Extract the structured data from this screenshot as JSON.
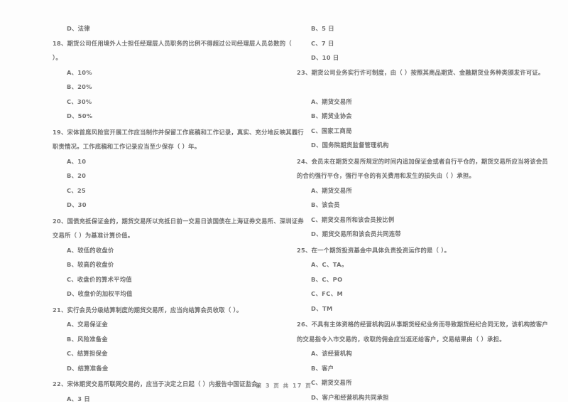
{
  "document": {
    "page_footer": "第 3 页  共 17 页",
    "page_number": "3",
    "total_pages": "17",
    "ink_color": "#5f5f5f",
    "paper_color": "#fdfdfd"
  },
  "left_column": {
    "orphan_option": "D、法律",
    "questions": [
      {
        "number": "18",
        "lines": [
          "18、期货公司任用境外人士担任经理层人员职务的比例不得超过公司经理层人员总数的（",
          "）。"
        ],
        "options": [
          "A、10%",
          "B、20%",
          "C、30%",
          "D、50%"
        ]
      },
      {
        "number": "19",
        "lines": [
          "19、宋体首席风险官开展工作应当制作并保留工作底稿和工作记录，真实、充分地反映其履行",
          "职责情况。工作底稿和工作记录应当至少保存（      ）年。"
        ],
        "options": [
          "A、10",
          "B、20",
          "C、25",
          "D、30"
        ]
      },
      {
        "number": "20",
        "lines": [
          "20、国债充抵保证金的，期货交易所以充抵日前一交易日该国债在上海证券交易所、深圳证券",
          "交易所（      ）为基准计算价值。"
        ],
        "options": [
          "A、较低的收盘价",
          "B、较高的收盘价",
          "C、收盘价的算术平均值",
          "D、收盘价的加权平均值"
        ]
      },
      {
        "number": "21",
        "lines": [
          "21、实行会员分级结算制度的期货交易所，应当向结算会员收取（      ）。"
        ],
        "options": [
          "A、交易保证金",
          "B、风险准备金",
          "C、结算担保金",
          "D、结算准备金"
        ]
      },
      {
        "number": "22",
        "lines": [
          "22、宋体期货交易所联网交易的，应当于决定之日起（      ）内报告中国证监会。"
        ],
        "options": [
          "A、3 日"
        ]
      }
    ]
  },
  "right_column": {
    "orphan_options": [
      "B、5 日",
      "C、7 日",
      "D、10 日"
    ],
    "questions": [
      {
        "number": "23",
        "lines": [
          "23、期货公司业务实行许可制度，由（      ）按照其商品期货、金融期货业务种类颁发许可证。"
        ],
        "options": [
          "A、期货交易所",
          "B、期货业协会",
          "C、国家工商局",
          "D、国务院期货监督管理机构"
        ]
      },
      {
        "number": "24",
        "lines": [
          "24、会员未在期货交易所规定的时间内追加保证金或者自行平仓的，期货交易所应当将该会员",
          "的合约强行平仓，强行平仓的有关费用和发生的损失由（      ）承担。"
        ],
        "options": [
          "A、期货交易所",
          "B、该会员",
          "C、期货交易所和该会员按比例",
          "D、期货交易所和该会员共同连带"
        ]
      },
      {
        "number": "25",
        "lines": [
          "25、在一个期货投资基金中具体负责投资运作的是（      ）。"
        ],
        "options": [
          "A、C、TA。",
          "B、C、PO",
          "C、FC、M",
          "D、TM"
        ]
      },
      {
        "number": "26",
        "lines": [
          "26、不具有主体资格的经营机构因从事期货经纪业务而导致期货经纪合同无效，该机构按客户",
          "的交易指令入市交易的，收取的佣金应当返还给客户，交易结果由（      ）承担。"
        ],
        "options": [
          "A、该经营机构",
          "B、客户",
          "C、期货交易所",
          "D、客户和经营机构共同承担"
        ]
      }
    ]
  }
}
